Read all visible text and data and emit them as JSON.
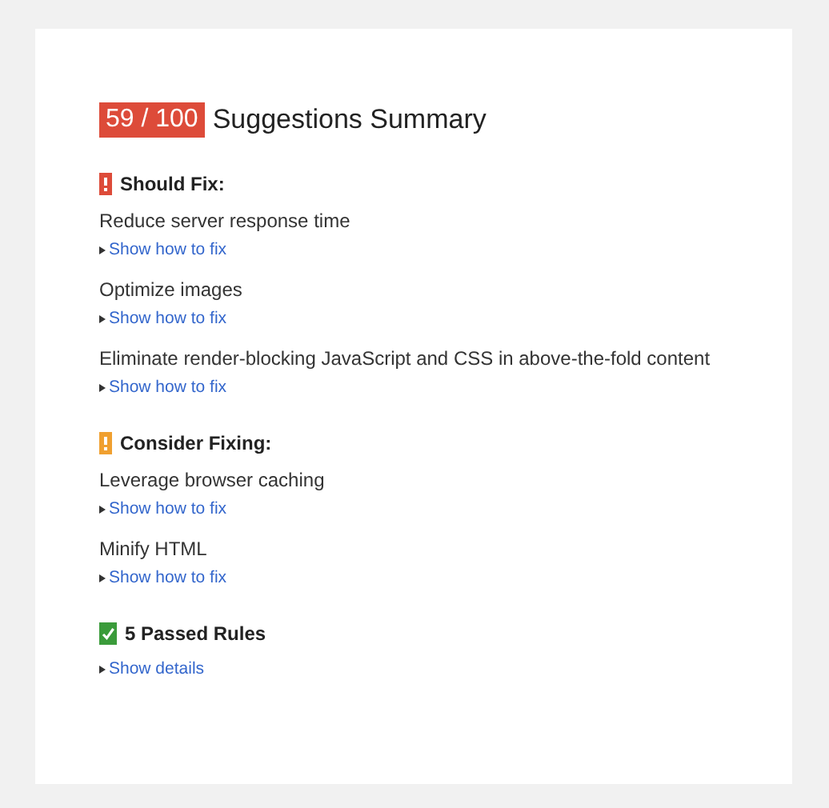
{
  "score": "59 / 100",
  "title": "Suggestions Summary",
  "sections": [
    {
      "kind": "error",
      "heading": "Should Fix:",
      "items": [
        {
          "text": "Reduce server response time",
          "link": "Show how to fix"
        },
        {
          "text": "Optimize images",
          "link": "Show how to fix"
        },
        {
          "text": "Eliminate render-blocking JavaScript and CSS in above-the-fold content",
          "link": "Show how to fix"
        }
      ]
    },
    {
      "kind": "warning",
      "heading": "Consider Fixing:",
      "items": [
        {
          "text": "Leverage browser caching",
          "link": "Show how to fix"
        },
        {
          "text": "Minify HTML",
          "link": "Show how to fix"
        }
      ]
    },
    {
      "kind": "pass",
      "heading": "5 Passed Rules",
      "items": [
        {
          "link": "Show details"
        }
      ]
    }
  ]
}
